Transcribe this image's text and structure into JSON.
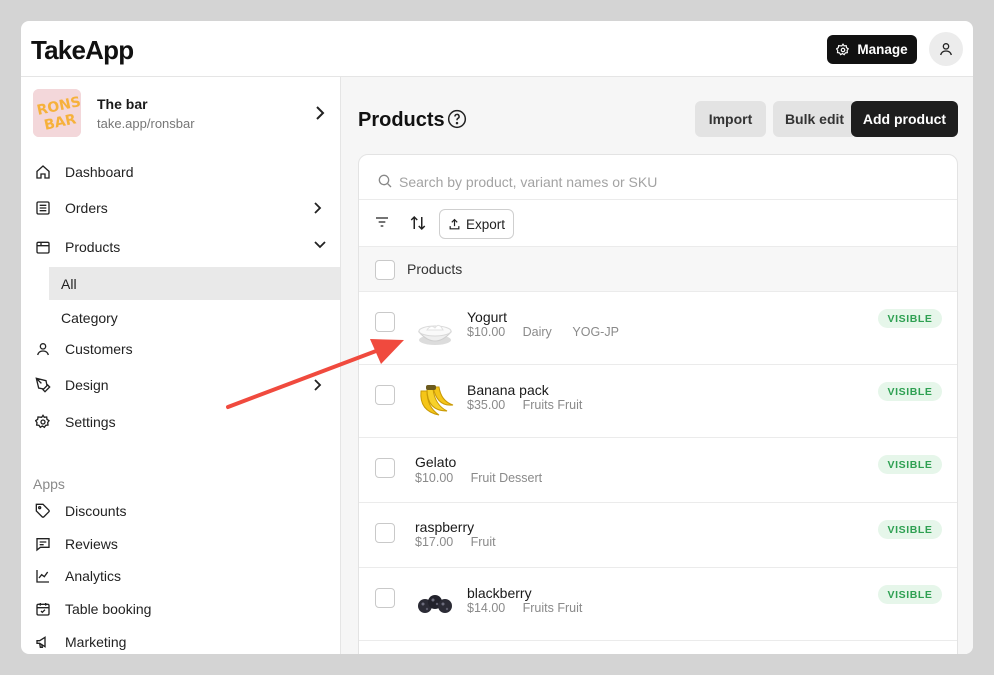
{
  "app": {
    "logo": "TakeApp"
  },
  "header": {
    "manage_label": "Manage"
  },
  "store": {
    "name": "The bar",
    "url": "take.app/ronsbar",
    "logo_text": "RONS BAR"
  },
  "sidebar": {
    "items": [
      {
        "label": "Dashboard"
      },
      {
        "label": "Orders"
      },
      {
        "label": "Products"
      },
      {
        "label": "All"
      },
      {
        "label": "Category"
      },
      {
        "label": "Customers"
      },
      {
        "label": "Design"
      },
      {
        "label": "Settings"
      }
    ],
    "apps_label": "Apps",
    "apps": [
      {
        "label": "Discounts"
      },
      {
        "label": "Reviews"
      },
      {
        "label": "Analytics"
      },
      {
        "label": "Table booking"
      },
      {
        "label": "Marketing"
      }
    ]
  },
  "main": {
    "title": "Products",
    "import_label": "Import",
    "bulk_edit_label": "Bulk edit",
    "add_product_label": "Add product",
    "search_placeholder": "Search by product, variant names or SKU",
    "export_label": "Export",
    "column_header": "Products"
  },
  "products": [
    {
      "name": "Yogurt",
      "meta": "$10.00     Dairy      YOG-JP",
      "status": "VISIBLE",
      "image": "yogurt-image"
    },
    {
      "name": "Banana pack",
      "meta": "$35.00     Fruits Fruit",
      "status": "VISIBLE",
      "image": "banana-image"
    },
    {
      "name": "Gelato",
      "meta": "$10.00     Fruit Dessert",
      "status": "VISIBLE"
    },
    {
      "name": "raspberry",
      "meta": "$17.00     Fruit",
      "status": "VISIBLE"
    },
    {
      "name": "blackberry",
      "meta": "$14.00     Fruits Fruit",
      "status": "VISIBLE",
      "image": "blackberry-image"
    }
  ],
  "colors": {
    "accent_dark": "#1e1e1e",
    "visible_badge": "#2ea052",
    "annotation_arrow": "#f04a3e"
  }
}
